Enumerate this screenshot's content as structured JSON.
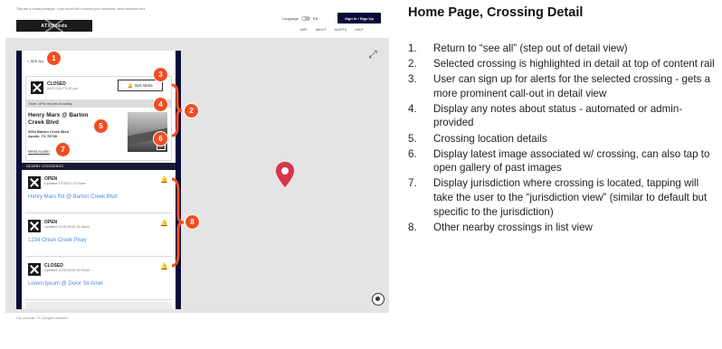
{
  "mockup": {
    "banner_text": "This site is a beta prototype. If you would like to submit your comments, send feedback here",
    "logo_text": "ATXfloods",
    "language_label": "Language",
    "language_value": "EN",
    "signin_label": "Sign In / Sign Up",
    "nav": [
      "MAP",
      "ABOUT",
      "ALERTS",
      "HELP"
    ],
    "footer_text": "City of Austin, TX. All rights reserved.",
    "rail": {
      "back_label": "< SEE ALL",
      "selected": {
        "status": "CLOSED",
        "updated": "04/27/2017 5:32 pm",
        "alerts_label": "Get Alerts",
        "note": "Note: APD reports flooding",
        "name": "Henry Marx @ Barton Creek Blvd",
        "address_line1": "5264 Barton Creek Blvd",
        "address_line2": "Austin, TX 78735",
        "jurisdiction": "West Austin"
      },
      "nearby_label": "NEARBY CROSSINGS",
      "nearby": [
        {
          "status": "OPEN",
          "updated": "Updated 1/1/2017 12:03am",
          "name": "Henry Marx Rd @ Barton Creek Blvd"
        },
        {
          "status": "OPEN",
          "updated": "Updated 12/31/2016 11:56pm",
          "name": "1234 Onion Creek Pkwy"
        },
        {
          "status": "CLOSED",
          "updated": "Updated 12/31/2016 11:57pm",
          "name": "Lorem Ipsum @ Dolor Sit Amet"
        }
      ]
    },
    "callouts": [
      "1",
      "2",
      "3",
      "4",
      "5",
      "6",
      "7",
      "8"
    ]
  },
  "panel": {
    "heading": "Home Page, Crossing Detail",
    "items": [
      {
        "num": "1.",
        "text": "Return to “see all” (step out of detail view)"
      },
      {
        "num": "2.",
        "text": "Selected crossing is highlighted in detail at top of content rail"
      },
      {
        "num": "3.",
        "text": "User can sign up for alerts for the selected crossing - gets a more prominent call-out in detail view"
      },
      {
        "num": "4.",
        "text": "Display any notes about status - automated or admin-provided"
      },
      {
        "num": "5.",
        "text": "Crossing location details"
      },
      {
        "num": "6.",
        "text": "Display latest image associated w/ crossing, can also tap to open gallery of past images"
      },
      {
        "num": "7.",
        "text": "Display jurisdiction where crossing is located, tapping will take the user to the “jurisdiction view” (similar to default but specific to the jurisdiction)"
      },
      {
        "num": "8.",
        "text": "Other nearby crossings in list view"
      }
    ]
  },
  "colors": {
    "accent": "#f04e23",
    "navy": "#0b0b3a",
    "link": "#4a8cd6"
  }
}
